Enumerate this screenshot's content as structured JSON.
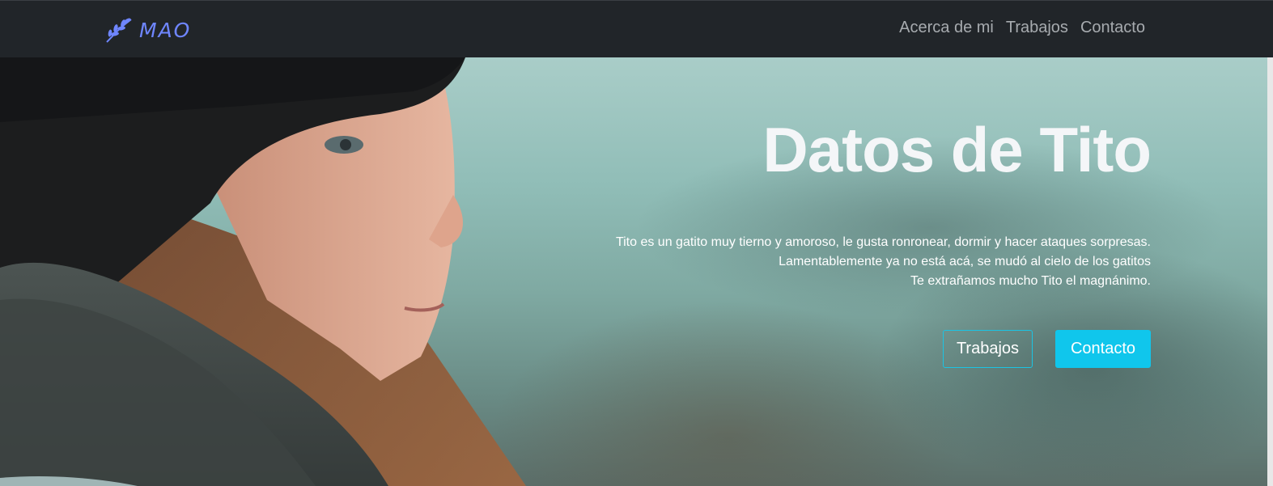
{
  "nav": {
    "brand": "MAO",
    "links": [
      "Acerca de mi",
      "Trabajos",
      "Contacto"
    ]
  },
  "hero": {
    "title": "Datos de Tito",
    "lines": [
      "Tito es un gatito muy tierno y amoroso, le gusta ronronear, dormir y hacer ataques sorpresas.",
      "Lamentablemente ya no está acá, se mudó al cielo de los gatitos",
      "Te extrañamos mucho Tito el magnánimo."
    ],
    "buttons": {
      "outline": "Trabajos",
      "solid": "Contacto"
    }
  },
  "icons": {
    "brand": "leaf-branch-icon"
  },
  "colors": {
    "navbar": "#212529",
    "brand": "#6f86ff",
    "accent": "#10c6ec"
  }
}
